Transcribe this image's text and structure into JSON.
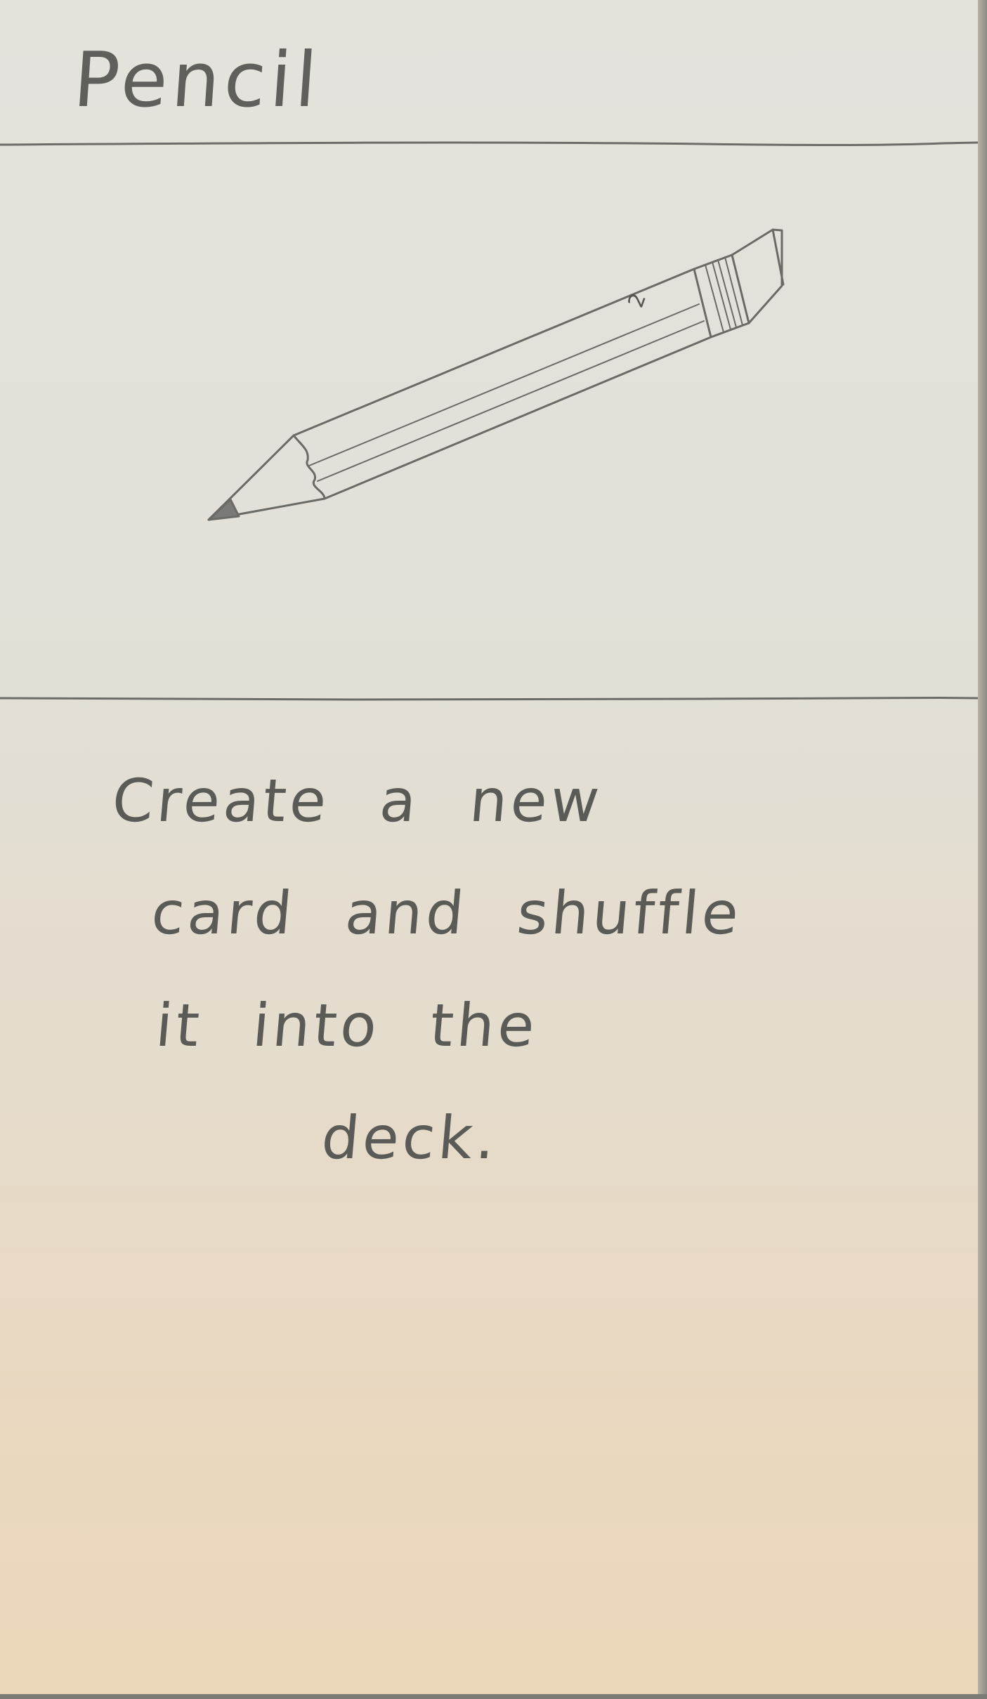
{
  "card": {
    "title": "Pencil",
    "art": {
      "icon": "pencil-icon",
      "pencil_number": "2"
    },
    "description_lines": [
      "Create a new",
      "card and shuffle",
      "it into the",
      "deck."
    ]
  },
  "colors": {
    "paper_top": "#e3e3dc",
    "paper_bottom": "#ecd7ba",
    "ink": "#5f5f5b"
  }
}
